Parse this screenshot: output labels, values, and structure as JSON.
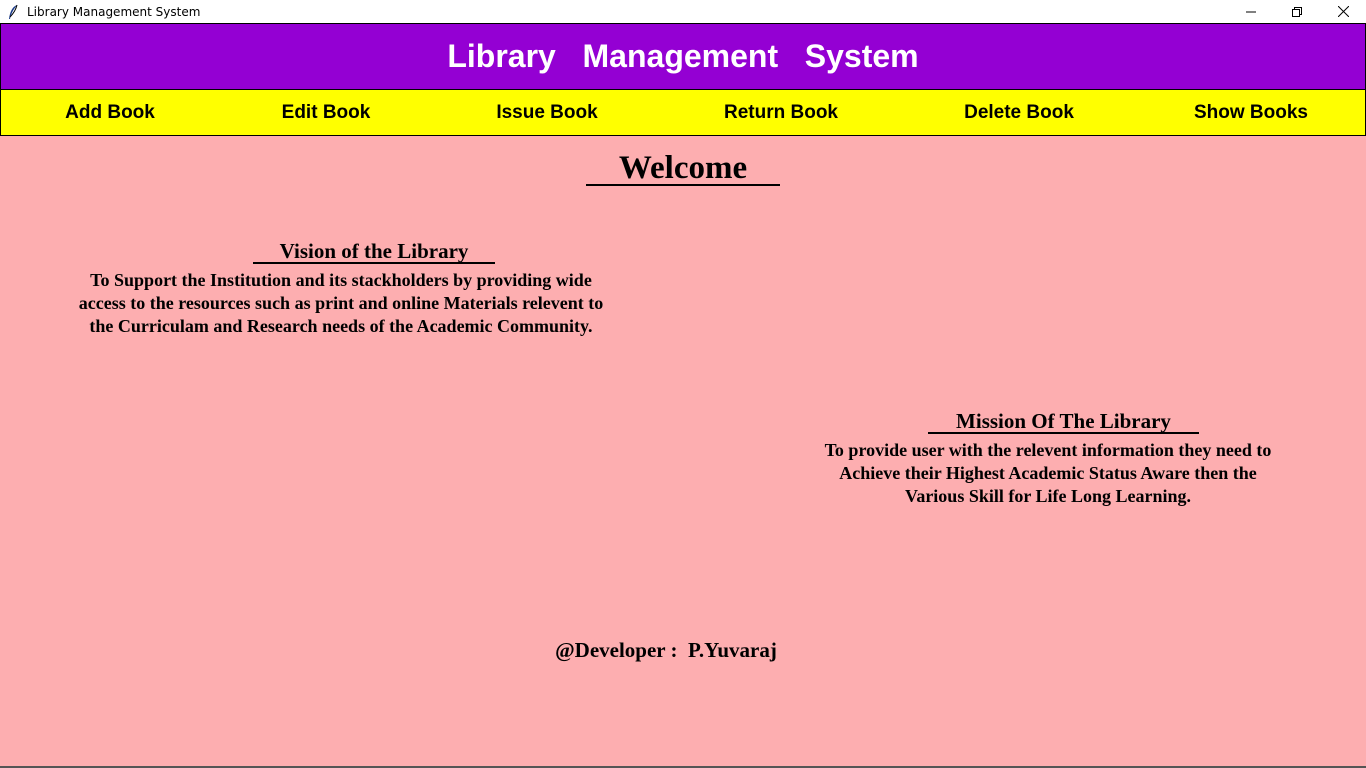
{
  "window": {
    "title": "Library Management System",
    "icon": "feather-icon",
    "controls": [
      "minimize-icon",
      "restore-icon",
      "close-icon"
    ]
  },
  "header": {
    "title": "Library   Management   System",
    "background": "#9400d3",
    "color": "#ffffff"
  },
  "menu": {
    "background": "#ffff00",
    "items": [
      {
        "label": "Add Book"
      },
      {
        "label": "Edit Book"
      },
      {
        "label": "Issue Book"
      },
      {
        "label": "Return Book"
      },
      {
        "label": "Delete Book"
      },
      {
        "label": "Show Books"
      }
    ]
  },
  "main": {
    "background": "#fdaeb0",
    "welcome": "Welcome",
    "vision": {
      "heading": "Vision of the Library",
      "lines": [
        "To Support the Institution and its stackholders by providing wide",
        "access to the resources such as print and online Materials relevent to",
        "the Curriculam and Research needs of the Academic Community."
      ]
    },
    "mission": {
      "heading": "Mission Of The Library",
      "lines": [
        "To provide user with the relevent information they need to",
        "Achieve their Highest Academic Status Aware then the",
        "Various Skill for Life Long Learning."
      ]
    },
    "developer": "@Developer :  P.Yuvaraj"
  }
}
